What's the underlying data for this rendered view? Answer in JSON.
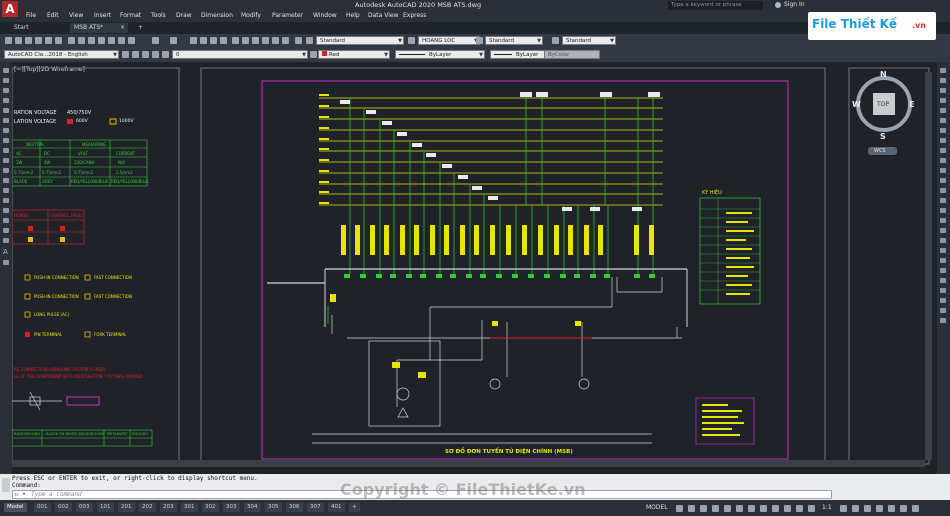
{
  "app": {
    "title": "Autodesk AutoCAD 2020   MSB ATS.dwg",
    "search_placeholder": "Type a keyword or phrase",
    "sign_in": "Sign In",
    "logo_letter": "A"
  },
  "menu": [
    "File",
    "Edit",
    "View",
    "Insert",
    "Format",
    "Tools",
    "Draw",
    "Dimension",
    "Modify",
    "Parameter",
    "Window",
    "Help",
    "Data View",
    "Express"
  ],
  "tabs": {
    "start": "Start",
    "doc": "MSB ATS*",
    "add": "+"
  },
  "toolbar": {
    "textstyle": "Standard",
    "dimstyle": "HOANG LOC",
    "tablestyle": "Standard",
    "mleaderstyle": "Standard",
    "workspace": "AutoCAD Cla...2018 - English",
    "layer": "0",
    "color": "Red",
    "linetype": "ByLayer",
    "lineweight": "ByLayer",
    "plotstyle": "ByColor"
  },
  "viewport": {
    "label": "[−][Top][2D Wireframe]"
  },
  "viewcube": {
    "top": "TOP",
    "n": "N",
    "s": "S",
    "e": "E",
    "w": "W",
    "wcs": "WCS"
  },
  "left_panel": {
    "insulation_voltage": "RATION VOLTAGE",
    "insulation_voltage_value": "450/750V",
    "lation_voltage": "LATION VOLTAGE",
    "v600": "600V",
    "v1000": "1000V",
    "table_headers": [
      "NEUTRAL",
      "",
      "MEASURING",
      ""
    ],
    "table_row1": [
      "AC",
      "DC",
      "VOLT",
      "CURRENT"
    ],
    "table_row2": [
      "3W",
      "4W",
      "220/CANH",
      "N/A"
    ],
    "table_row3": [
      "0.75mm2",
      "0.75mm2",
      "0.75mm2",
      "2.5mm2"
    ],
    "table_row4": [
      "BLACK",
      "GREY",
      "RED/YELLOW/BLUE",
      "RED/YELLOW/BLUE"
    ],
    "control_label": "CONTROL FIELD",
    "power_label": "POWER",
    "push_in": "PUSH-IN CONNECTION",
    "fast_connection": "FAST CONNECTION",
    "long_pulse": "LONG PULSE (AC)",
    "pin_terminal": "PIN TERMINAL",
    "fork_terminal": "FORK TERMINAL",
    "red_note1": "RE CONNECTION LABELLING SYSTEM IS USED",
    "red_note2": "LE OF THE COMPONENT WITH DESIGNATION \"-F1\" WAS MARKED",
    "bottom_headers": [
      "BACKGROUND",
      "BLACK ON WHITE BACKGROUND",
      "METAMATIC",
      "ENGLISH"
    ]
  },
  "legend_title": "KÝ HIỆU",
  "drawing_title": "SƠ ĐỒ ĐƠN TUYẾN TỦ ĐIỆN CHÍNH (MSB)",
  "cmd": {
    "history1": "Press ESC or ENTER to exit, or right-click to display shortcut menu.",
    "history2": "Command:",
    "placeholder": "Type a command",
    "prompt": "▷ •"
  },
  "layout_tabs": [
    "Model",
    "001",
    "002",
    "003",
    "101",
    "201",
    "202",
    "203",
    "301",
    "302",
    "303",
    "304",
    "305",
    "306",
    "307",
    "401",
    "+"
  ],
  "status": {
    "mode": "MODEL",
    "scale": "1:1"
  },
  "watermark": {
    "brand": "File Thiết Kế",
    "brand_tld": ".vn",
    "copyright": "Copyright © FileThietKe.vn"
  },
  "colors": {
    "accent": "#b6262a",
    "bg": "#1f2329",
    "bus": "#e6e600",
    "purple": "#c030c0",
    "green": "#33cc33",
    "red": "#e02020"
  }
}
